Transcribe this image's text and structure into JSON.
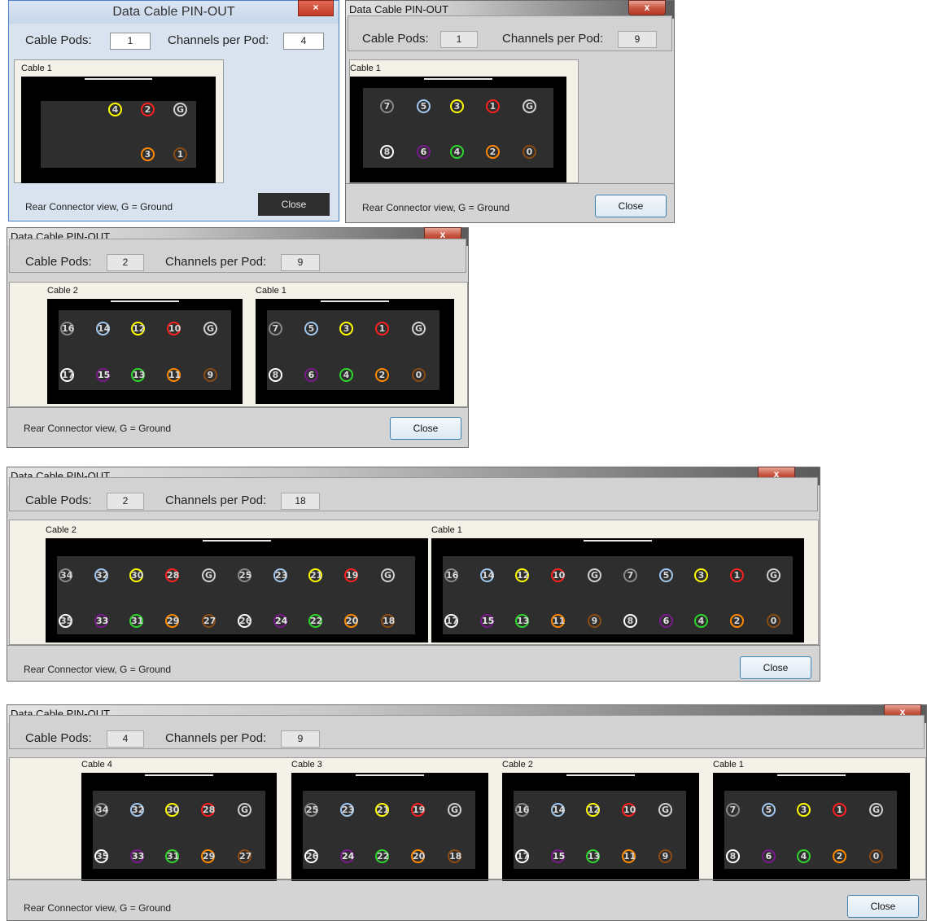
{
  "windows": [
    {
      "title": "Data Cable PIN-OUT",
      "close_glyph": "×",
      "cable_pods_label": "Cable Pods:",
      "cable_pods": "1",
      "channels_label": "Channels per Pod:",
      "channels": "4",
      "cables": [
        {
          "label": "Cable 1",
          "top": [
            {
              "t": "4",
              "c": "#ffff00"
            },
            {
              "t": "2",
              "c": "#ff2020"
            },
            {
              "t": "G",
              "c": "#d0d0d0"
            }
          ],
          "bottom": [
            {
              "t": "3",
              "c": "#ff8a00"
            },
            {
              "t": "1",
              "c": "#8b4c14"
            }
          ]
        }
      ],
      "footer": "Rear Connector view,  G = Ground",
      "close_label": "Close"
    },
    {
      "title": "Data Cable PIN-OUT",
      "close_glyph": "x",
      "cable_pods_label": "Cable Pods:",
      "cable_pods": "1",
      "channels_label": "Channels per Pod:",
      "channels": "9",
      "cables": [
        {
          "label": "Cable 1",
          "top": [
            {
              "t": "7",
              "c": "#8a8a8a"
            },
            {
              "t": "5",
              "c": "#9fc8f0"
            },
            {
              "t": "3",
              "c": "#ffff00"
            },
            {
              "t": "1",
              "c": "#ff2020"
            },
            {
              "t": "G",
              "c": "#d0d0d0"
            }
          ],
          "bottom": [
            {
              "t": "8",
              "c": "#ffffff"
            },
            {
              "t": "6",
              "c": "#7a1a8c"
            },
            {
              "t": "4",
              "c": "#2ed62e"
            },
            {
              "t": "2",
              "c": "#ff8a00"
            },
            {
              "t": "0",
              "c": "#8b4c14"
            }
          ]
        }
      ],
      "footer": "Rear Connector view,  G = Ground",
      "close_label": "Close"
    },
    {
      "title": "Data Cable PIN-OUT",
      "close_glyph": "x",
      "cable_pods_label": "Cable Pods:",
      "cable_pods": "2",
      "channels_label": "Channels per Pod:",
      "channels": "9",
      "cables": [
        {
          "label": "Cable 2",
          "top": [
            {
              "t": "16",
              "c": "#8a8a8a"
            },
            {
              "t": "14",
              "c": "#9fc8f0"
            },
            {
              "t": "12",
              "c": "#ffff00"
            },
            {
              "t": "10",
              "c": "#ff2020"
            },
            {
              "t": "G",
              "c": "#d0d0d0"
            }
          ],
          "bottom": [
            {
              "t": "17",
              "c": "#ffffff"
            },
            {
              "t": "15",
              "c": "#7a1a8c"
            },
            {
              "t": "13",
              "c": "#2ed62e"
            },
            {
              "t": "11",
              "c": "#ff8a00"
            },
            {
              "t": "9",
              "c": "#8b4c14"
            }
          ]
        },
        {
          "label": "Cable 1",
          "top": [
            {
              "t": "7",
              "c": "#8a8a8a"
            },
            {
              "t": "5",
              "c": "#9fc8f0"
            },
            {
              "t": "3",
              "c": "#ffff00"
            },
            {
              "t": "1",
              "c": "#ff2020"
            },
            {
              "t": "G",
              "c": "#d0d0d0"
            }
          ],
          "bottom": [
            {
              "t": "8",
              "c": "#ffffff"
            },
            {
              "t": "6",
              "c": "#7a1a8c"
            },
            {
              "t": "4",
              "c": "#2ed62e"
            },
            {
              "t": "2",
              "c": "#ff8a00"
            },
            {
              "t": "0",
              "c": "#8b4c14"
            }
          ]
        }
      ],
      "footer": "Rear Connector view,  G = Ground",
      "close_label": "Close"
    },
    {
      "title": "Data Cable PIN-OUT",
      "close_glyph": "x",
      "cable_pods_label": "Cable Pods:",
      "cable_pods": "2",
      "channels_label": "Channels per Pod:",
      "channels": "18",
      "cables": [
        {
          "label": "Cable 2",
          "top": [
            {
              "t": "34",
              "c": "#8a8a8a"
            },
            {
              "t": "32",
              "c": "#9fc8f0"
            },
            {
              "t": "30",
              "c": "#ffff00"
            },
            {
              "t": "28",
              "c": "#ff2020"
            },
            {
              "t": "G",
              "c": "#d0d0d0"
            },
            {
              "t": "25",
              "c": "#8a8a8a"
            },
            {
              "t": "23",
              "c": "#9fc8f0"
            },
            {
              "t": "21",
              "c": "#ffff00"
            },
            {
              "t": "19",
              "c": "#ff2020"
            },
            {
              "t": "G",
              "c": "#d0d0d0"
            }
          ],
          "bottom": [
            {
              "t": "35",
              "c": "#ffffff"
            },
            {
              "t": "33",
              "c": "#7a1a8c"
            },
            {
              "t": "31",
              "c": "#2ed62e"
            },
            {
              "t": "29",
              "c": "#ff8a00"
            },
            {
              "t": "27",
              "c": "#8b4c14"
            },
            {
              "t": "26",
              "c": "#ffffff"
            },
            {
              "t": "24",
              "c": "#7a1a8c"
            },
            {
              "t": "22",
              "c": "#2ed62e"
            },
            {
              "t": "20",
              "c": "#ff8a00"
            },
            {
              "t": "18",
              "c": "#8b4c14"
            }
          ]
        },
        {
          "label": "Cable 1",
          "top": [
            {
              "t": "16",
              "c": "#8a8a8a"
            },
            {
              "t": "14",
              "c": "#9fc8f0"
            },
            {
              "t": "12",
              "c": "#ffff00"
            },
            {
              "t": "10",
              "c": "#ff2020"
            },
            {
              "t": "G",
              "c": "#d0d0d0"
            },
            {
              "t": "7",
              "c": "#8a8a8a"
            },
            {
              "t": "5",
              "c": "#9fc8f0"
            },
            {
              "t": "3",
              "c": "#ffff00"
            },
            {
              "t": "1",
              "c": "#ff2020"
            },
            {
              "t": "G",
              "c": "#d0d0d0"
            }
          ],
          "bottom": [
            {
              "t": "17",
              "c": "#ffffff"
            },
            {
              "t": "15",
              "c": "#7a1a8c"
            },
            {
              "t": "13",
              "c": "#2ed62e"
            },
            {
              "t": "11",
              "c": "#ff8a00"
            },
            {
              "t": "9",
              "c": "#8b4c14"
            },
            {
              "t": "8",
              "c": "#ffffff"
            },
            {
              "t": "6",
              "c": "#7a1a8c"
            },
            {
              "t": "4",
              "c": "#2ed62e"
            },
            {
              "t": "2",
              "c": "#ff8a00"
            },
            {
              "t": "0",
              "c": "#8b4c14"
            }
          ]
        }
      ],
      "footer": "Rear Connector view,  G = Ground",
      "close_label": "Close"
    },
    {
      "title": "Data Cable PIN-OUT",
      "close_glyph": "x",
      "cable_pods_label": "Cable Pods:",
      "cable_pods": "4",
      "channels_label": "Channels per Pod:",
      "channels": "9",
      "cables": [
        {
          "label": "Cable 4",
          "top": [
            {
              "t": "34",
              "c": "#8a8a8a"
            },
            {
              "t": "32",
              "c": "#9fc8f0"
            },
            {
              "t": "30",
              "c": "#ffff00"
            },
            {
              "t": "28",
              "c": "#ff2020"
            },
            {
              "t": "G",
              "c": "#d0d0d0"
            }
          ],
          "bottom": [
            {
              "t": "35",
              "c": "#ffffff"
            },
            {
              "t": "33",
              "c": "#7a1a8c"
            },
            {
              "t": "31",
              "c": "#2ed62e"
            },
            {
              "t": "29",
              "c": "#ff8a00"
            },
            {
              "t": "27",
              "c": "#8b4c14"
            }
          ]
        },
        {
          "label": "Cable 3",
          "top": [
            {
              "t": "25",
              "c": "#8a8a8a"
            },
            {
              "t": "23",
              "c": "#9fc8f0"
            },
            {
              "t": "21",
              "c": "#ffff00"
            },
            {
              "t": "19",
              "c": "#ff2020"
            },
            {
              "t": "G",
              "c": "#d0d0d0"
            }
          ],
          "bottom": [
            {
              "t": "26",
              "c": "#ffffff"
            },
            {
              "t": "24",
              "c": "#7a1a8c"
            },
            {
              "t": "22",
              "c": "#2ed62e"
            },
            {
              "t": "20",
              "c": "#ff8a00"
            },
            {
              "t": "18",
              "c": "#8b4c14"
            }
          ]
        },
        {
          "label": "Cable 2",
          "top": [
            {
              "t": "16",
              "c": "#8a8a8a"
            },
            {
              "t": "14",
              "c": "#9fc8f0"
            },
            {
              "t": "12",
              "c": "#ffff00"
            },
            {
              "t": "10",
              "c": "#ff2020"
            },
            {
              "t": "G",
              "c": "#d0d0d0"
            }
          ],
          "bottom": [
            {
              "t": "17",
              "c": "#ffffff"
            },
            {
              "t": "15",
              "c": "#7a1a8c"
            },
            {
              "t": "13",
              "c": "#2ed62e"
            },
            {
              "t": "11",
              "c": "#ff8a00"
            },
            {
              "t": "9",
              "c": "#8b4c14"
            }
          ]
        },
        {
          "label": "Cable 1",
          "top": [
            {
              "t": "7",
              "c": "#8a8a8a"
            },
            {
              "t": "5",
              "c": "#9fc8f0"
            },
            {
              "t": "3",
              "c": "#ffff00"
            },
            {
              "t": "1",
              "c": "#ff2020"
            },
            {
              "t": "G",
              "c": "#d0d0d0"
            }
          ],
          "bottom": [
            {
              "t": "8",
              "c": "#ffffff"
            },
            {
              "t": "6",
              "c": "#7a1a8c"
            },
            {
              "t": "4",
              "c": "#2ed62e"
            },
            {
              "t": "2",
              "c": "#ff8a00"
            },
            {
              "t": "0",
              "c": "#8b4c14"
            }
          ]
        }
      ],
      "footer": "Rear Connector view,  G = Ground",
      "close_label": "Close"
    }
  ]
}
